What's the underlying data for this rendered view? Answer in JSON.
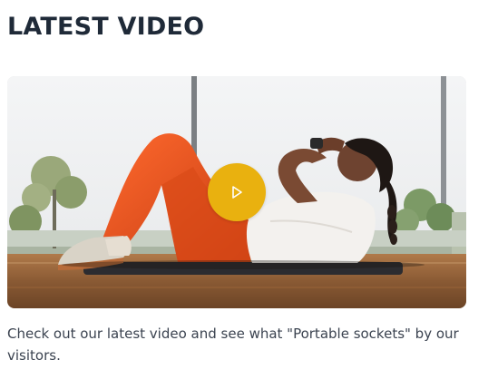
{
  "section": {
    "title": "LATEST VIDEO",
    "description": "Check out our latest video and see what \"Portable sockets\" by our visitors."
  },
  "video": {
    "play_icon": "play-icon",
    "accent_color": "#e9b10f"
  }
}
